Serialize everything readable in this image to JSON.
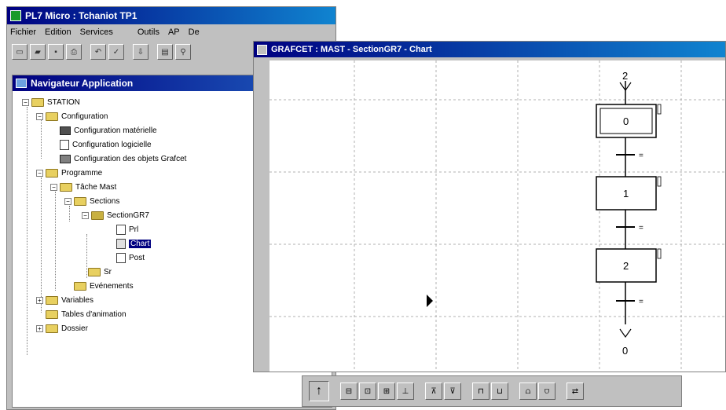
{
  "app": {
    "title": "PL7 Micro : Tchaniot TP1",
    "menu": [
      "Fichier",
      "Edition",
      "Services",
      "Outils",
      "AP",
      "De"
    ]
  },
  "navigator": {
    "title": "Navigateur Application",
    "nodes": {
      "station": "STATION",
      "configuration": "Configuration",
      "config_materielle": "Configuration matérielle",
      "config_logicielle": "Configuration logicielle",
      "config_grafcet": "Configuration des objets Grafcet",
      "programme": "Programme",
      "tache_mast": "Tâche Mast",
      "sections": "Sections",
      "section_gr7": "SectionGR7",
      "prl": "Prl",
      "chart": "Chart",
      "post": "Post",
      "sr": "Sr",
      "evenements": "Evénements",
      "variables": "Variables",
      "tables_animation": "Tables d'animation",
      "dossier": "Dossier"
    }
  },
  "grafcet": {
    "title": "GRAFCET : MAST - SectionGR7 - Chart",
    "top_jump": "2",
    "bottom_jump": "0",
    "steps": [
      "0",
      "1",
      "2"
    ],
    "transition_mark": "="
  }
}
